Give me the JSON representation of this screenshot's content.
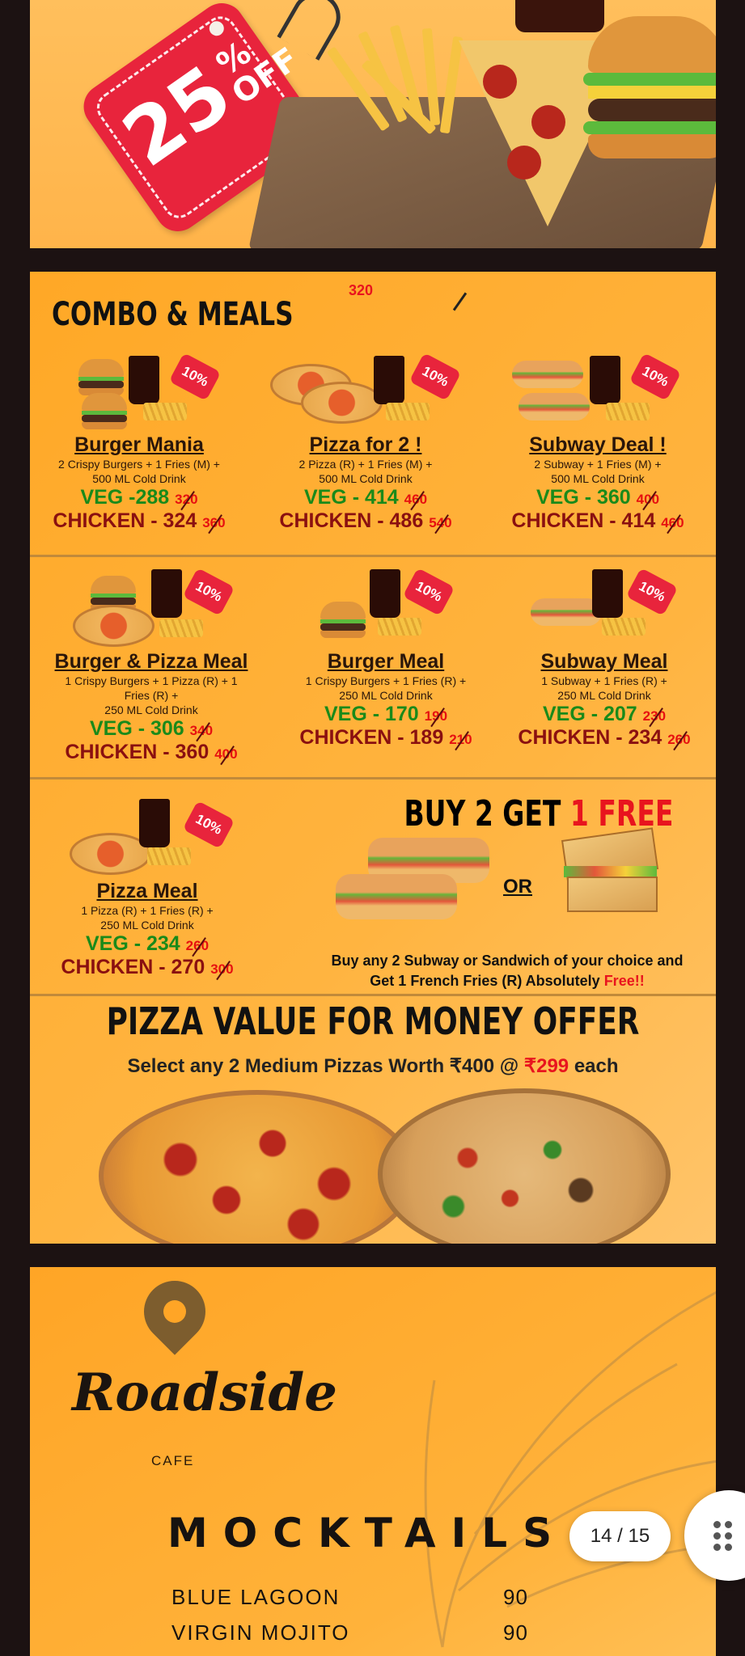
{
  "hero": {
    "discount_number": "25",
    "discount_percent": "%",
    "discount_off": "OFF"
  },
  "combo": {
    "title": "COMBO & MEALS",
    "stray_price": "320",
    "items": [
      {
        "name": "Burger Mania",
        "desc1": "2 Crispy Burgers + 1 Fries (M) +",
        "desc2": "500 ML Cold Drink",
        "veg": "VEG -288",
        "veg_old": "320",
        "chicken": "CHICKEN - 324",
        "chicken_old": "360",
        "badge": "10%"
      },
      {
        "name": "Pizza for 2 !",
        "desc1": "2 Pizza (R) + 1 Fries (M) +",
        "desc2": "500 ML Cold Drink",
        "veg": "VEG - 414",
        "veg_old": "460",
        "chicken": "CHICKEN - 486",
        "chicken_old": "540",
        "badge": "10%"
      },
      {
        "name": "Subway Deal !",
        "desc1": "2 Subway + 1 Fries (M) +",
        "desc2": "500 ML Cold Drink",
        "veg": "VEG - 360",
        "veg_old": "400",
        "chicken": "CHICKEN - 414",
        "chicken_old": "460",
        "badge": "10%"
      },
      {
        "name": "Burger & Pizza Meal",
        "desc1": "1 Crispy Burgers + 1 Pizza (R) + 1",
        "desc2": "Fries (R) +",
        "desc3": "250 ML Cold Drink",
        "veg": "VEG - 306",
        "veg_old": "340",
        "chicken": "CHICKEN - 360",
        "chicken_old": "400",
        "badge": "10%"
      },
      {
        "name": "Burger Meal",
        "desc1": "1 Crispy Burgers + 1 Fries (R) +",
        "desc2": "250 ML Cold Drink",
        "veg": "VEG - 170",
        "veg_old": "190",
        "chicken": "CHICKEN - 189",
        "chicken_old": "210",
        "badge": "10%"
      },
      {
        "name": "Subway Meal",
        "desc1": "1 Subway + 1 Fries (R) +",
        "desc2": "250 ML Cold Drink",
        "veg": "VEG - 207",
        "veg_old": "230",
        "chicken": "CHICKEN - 234",
        "chicken_old": "260",
        "badge": "10%"
      },
      {
        "name": "Pizza Meal",
        "desc1": "1 Pizza (R) + 1 Fries (R) +",
        "desc2": "250 ML Cold Drink",
        "veg": "VEG - 234",
        "veg_old": "260",
        "chicken": "CHICKEN - 270",
        "chicken_old": "300",
        "badge": "10%"
      }
    ],
    "b2g": {
      "head": "BUY 2 GET ",
      "head_red": "1 FREE",
      "or": "OR",
      "text1": "Buy any 2 Subway or Sandwich of your choice and",
      "text2": "Get 1 French Fries (R) Absolutely ",
      "free": "Free!!"
    },
    "pvm": {
      "title": "PIZZA VALUE FOR MONEY OFFER",
      "sub1": "Select any 2 Medium Pizzas Worth ₹400 @ ",
      "sub_red": "₹299",
      "sub2": " each"
    }
  },
  "mocktails": {
    "brand": "Roadside",
    "cafe": "CAFE",
    "title": "MOCKTAILS",
    "items": [
      {
        "name": "BLUE LAGOON",
        "price": "90"
      },
      {
        "name": "VIRGIN MOJITO",
        "price": "90"
      }
    ]
  },
  "pager": {
    "label": "14 / 15"
  },
  "colors": {
    "accent": "#ffa826",
    "red": "#e8141e",
    "veg": "#1a8a1a",
    "chicken": "#8a1010"
  }
}
